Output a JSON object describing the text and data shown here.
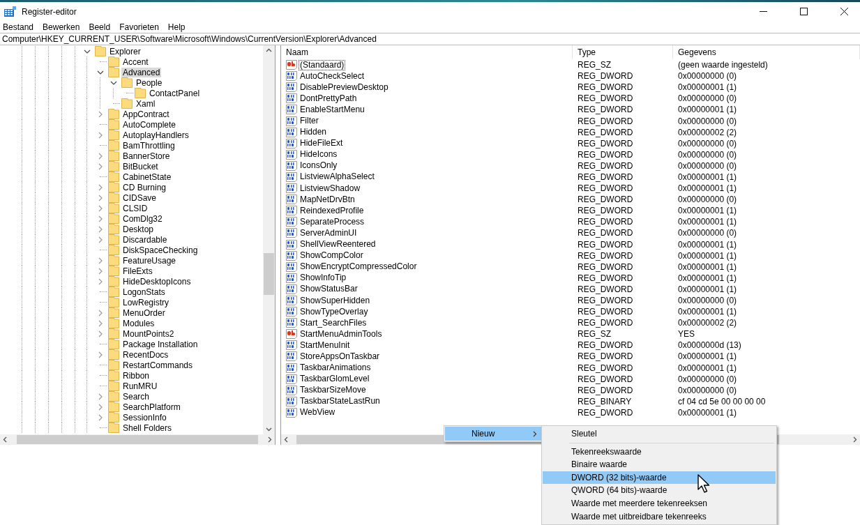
{
  "window": {
    "title": "Register-editor"
  },
  "menu": [
    "Bestand",
    "Bewerken",
    "Beeld",
    "Favorieten",
    "Help"
  ],
  "address": {
    "value": "Computer\\HKEY_CURRENT_USER\\Software\\Microsoft\\Windows\\CurrentVersion\\Explorer\\Advanced"
  },
  "tree": [
    {
      "label": "Explorer",
      "expandable": true,
      "expanded": true,
      "selected": false,
      "children": [
        {
          "label": "Accent",
          "expandable": false,
          "expanded": false,
          "selected": false
        },
        {
          "label": "Advanced",
          "expandable": true,
          "expanded": true,
          "selected": true,
          "children": [
            {
              "label": "People",
              "expandable": true,
              "expanded": true,
              "selected": false,
              "children": [
                {
                  "label": "ContactPanel",
                  "expandable": false,
                  "expanded": false,
                  "selected": false
                }
              ]
            },
            {
              "label": "Xaml",
              "expandable": false,
              "expanded": false,
              "selected": false
            }
          ]
        },
        {
          "label": "AppContract",
          "expandable": true,
          "expanded": false,
          "selected": false
        },
        {
          "label": "AutoComplete",
          "expandable": false,
          "expanded": false,
          "selected": false
        },
        {
          "label": "AutoplayHandlers",
          "expandable": true,
          "expanded": false,
          "selected": false
        },
        {
          "label": "BamThrottling",
          "expandable": false,
          "expanded": false,
          "selected": false
        },
        {
          "label": "BannerStore",
          "expandable": true,
          "expanded": false,
          "selected": false
        },
        {
          "label": "BitBucket",
          "expandable": true,
          "expanded": false,
          "selected": false
        },
        {
          "label": "CabinetState",
          "expandable": false,
          "expanded": false,
          "selected": false
        },
        {
          "label": "CD Burning",
          "expandable": true,
          "expanded": false,
          "selected": false
        },
        {
          "label": "CIDSave",
          "expandable": true,
          "expanded": false,
          "selected": false
        },
        {
          "label": "CLSID",
          "expandable": true,
          "expanded": false,
          "selected": false
        },
        {
          "label": "ComDlg32",
          "expandable": true,
          "expanded": false,
          "selected": false
        },
        {
          "label": "Desktop",
          "expandable": true,
          "expanded": false,
          "selected": false
        },
        {
          "label": "Discardable",
          "expandable": true,
          "expanded": false,
          "selected": false
        },
        {
          "label": "DiskSpaceChecking",
          "expandable": false,
          "expanded": false,
          "selected": false
        },
        {
          "label": "FeatureUsage",
          "expandable": true,
          "expanded": false,
          "selected": false
        },
        {
          "label": "FileExts",
          "expandable": true,
          "expanded": false,
          "selected": false
        },
        {
          "label": "HideDesktopIcons",
          "expandable": true,
          "expanded": false,
          "selected": false
        },
        {
          "label": "LogonStats",
          "expandable": false,
          "expanded": false,
          "selected": false
        },
        {
          "label": "LowRegistry",
          "expandable": false,
          "expanded": false,
          "selected": false
        },
        {
          "label": "MenuOrder",
          "expandable": true,
          "expanded": false,
          "selected": false
        },
        {
          "label": "Modules",
          "expandable": true,
          "expanded": false,
          "selected": false
        },
        {
          "label": "MountPoints2",
          "expandable": true,
          "expanded": false,
          "selected": false
        },
        {
          "label": "Package Installation",
          "expandable": false,
          "expanded": false,
          "selected": false
        },
        {
          "label": "RecentDocs",
          "expandable": true,
          "expanded": false,
          "selected": false
        },
        {
          "label": "RestartCommands",
          "expandable": false,
          "expanded": false,
          "selected": false
        },
        {
          "label": "Ribbon",
          "expandable": false,
          "expanded": false,
          "selected": false
        },
        {
          "label": "RunMRU",
          "expandable": false,
          "expanded": false,
          "selected": false
        },
        {
          "label": "Search",
          "expandable": true,
          "expanded": false,
          "selected": false
        },
        {
          "label": "SearchPlatform",
          "expandable": true,
          "expanded": false,
          "selected": false
        },
        {
          "label": "SessionInfo",
          "expandable": true,
          "expanded": false,
          "selected": false
        },
        {
          "label": "Shell Folders",
          "expandable": false,
          "expanded": false,
          "selected": false
        }
      ]
    }
  ],
  "table": {
    "columns": [
      "Naam",
      "Type",
      "Gegevens"
    ],
    "rows": [
      {
        "kind": "string",
        "focused": true,
        "name": "(Standaard)",
        "type": "REG_SZ",
        "data": "(geen waarde ingesteld)"
      },
      {
        "kind": "dword",
        "focused": false,
        "name": "AutoCheckSelect",
        "type": "REG_DWORD",
        "data": "0x00000000 (0)"
      },
      {
        "kind": "dword",
        "focused": false,
        "name": "DisablePreviewDesktop",
        "type": "REG_DWORD",
        "data": "0x00000001 (1)"
      },
      {
        "kind": "dword",
        "focused": false,
        "name": "DontPrettyPath",
        "type": "REG_DWORD",
        "data": "0x00000000 (0)"
      },
      {
        "kind": "dword",
        "focused": false,
        "name": "EnableStartMenu",
        "type": "REG_DWORD",
        "data": "0x00000001 (1)"
      },
      {
        "kind": "dword",
        "focused": false,
        "name": "Filter",
        "type": "REG_DWORD",
        "data": "0x00000000 (0)"
      },
      {
        "kind": "dword",
        "focused": false,
        "name": "Hidden",
        "type": "REG_DWORD",
        "data": "0x00000002 (2)"
      },
      {
        "kind": "dword",
        "focused": false,
        "name": "HideFileExt",
        "type": "REG_DWORD",
        "data": "0x00000000 (0)"
      },
      {
        "kind": "dword",
        "focused": false,
        "name": "HideIcons",
        "type": "REG_DWORD",
        "data": "0x00000000 (0)"
      },
      {
        "kind": "dword",
        "focused": false,
        "name": "IconsOnly",
        "type": "REG_DWORD",
        "data": "0x00000000 (0)"
      },
      {
        "kind": "dword",
        "focused": false,
        "name": "ListviewAlphaSelect",
        "type": "REG_DWORD",
        "data": "0x00000001 (1)"
      },
      {
        "kind": "dword",
        "focused": false,
        "name": "ListviewShadow",
        "type": "REG_DWORD",
        "data": "0x00000001 (1)"
      },
      {
        "kind": "dword",
        "focused": false,
        "name": "MapNetDrvBtn",
        "type": "REG_DWORD",
        "data": "0x00000000 (0)"
      },
      {
        "kind": "dword",
        "focused": false,
        "name": "ReindexedProfile",
        "type": "REG_DWORD",
        "data": "0x00000001 (1)"
      },
      {
        "kind": "dword",
        "focused": false,
        "name": "SeparateProcess",
        "type": "REG_DWORD",
        "data": "0x00000001 (1)"
      },
      {
        "kind": "dword",
        "focused": false,
        "name": "ServerAdminUI",
        "type": "REG_DWORD",
        "data": "0x00000000 (0)"
      },
      {
        "kind": "dword",
        "focused": false,
        "name": "ShellViewReentered",
        "type": "REG_DWORD",
        "data": "0x00000001 (1)"
      },
      {
        "kind": "dword",
        "focused": false,
        "name": "ShowCompColor",
        "type": "REG_DWORD",
        "data": "0x00000001 (1)"
      },
      {
        "kind": "dword",
        "focused": false,
        "name": "ShowEncryptCompressedColor",
        "type": "REG_DWORD",
        "data": "0x00000001 (1)"
      },
      {
        "kind": "dword",
        "focused": false,
        "name": "ShowInfoTip",
        "type": "REG_DWORD",
        "data": "0x00000001 (1)"
      },
      {
        "kind": "dword",
        "focused": false,
        "name": "ShowStatusBar",
        "type": "REG_DWORD",
        "data": "0x00000001 (1)"
      },
      {
        "kind": "dword",
        "focused": false,
        "name": "ShowSuperHidden",
        "type": "REG_DWORD",
        "data": "0x00000000 (0)"
      },
      {
        "kind": "dword",
        "focused": false,
        "name": "ShowTypeOverlay",
        "type": "REG_DWORD",
        "data": "0x00000001 (1)"
      },
      {
        "kind": "dword",
        "focused": false,
        "name": "Start_SearchFiles",
        "type": "REG_DWORD",
        "data": "0x00000002 (2)"
      },
      {
        "kind": "string",
        "focused": false,
        "name": "StartMenuAdminTools",
        "type": "REG_SZ",
        "data": "YES"
      },
      {
        "kind": "dword",
        "focused": false,
        "name": "StartMenuInit",
        "type": "REG_DWORD",
        "data": "0x0000000d (13)"
      },
      {
        "kind": "dword",
        "focused": false,
        "name": "StoreAppsOnTaskbar",
        "type": "REG_DWORD",
        "data": "0x00000001 (1)"
      },
      {
        "kind": "dword",
        "focused": false,
        "name": "TaskbarAnimations",
        "type": "REG_DWORD",
        "data": "0x00000001 (1)"
      },
      {
        "kind": "dword",
        "focused": false,
        "name": "TaskbarGlomLevel",
        "type": "REG_DWORD",
        "data": "0x00000000 (0)"
      },
      {
        "kind": "dword",
        "focused": false,
        "name": "TaskbarSizeMove",
        "type": "REG_DWORD",
        "data": "0x00000000 (0)"
      },
      {
        "kind": "binary",
        "focused": false,
        "name": "TaskbarStateLastRun",
        "type": "REG_BINARY",
        "data": "cf 04 cd 5e 00 00 00 00"
      },
      {
        "kind": "dword",
        "focused": false,
        "name": "WebView",
        "type": "REG_DWORD",
        "data": "0x00000001 (1)"
      }
    ]
  },
  "context_menu": {
    "items": [
      {
        "label": "Nieuw",
        "selected": true
      }
    ]
  },
  "submenu": {
    "groups": [
      [
        {
          "label": "Sleutel",
          "selected": false
        }
      ],
      [
        {
          "label": "Tekenreekswaarde",
          "selected": false
        },
        {
          "label": "Binaire waarde",
          "selected": false
        },
        {
          "label": "DWORD (32 bits)-waarde",
          "selected": true
        },
        {
          "label": "QWORD (64 bits)-waarde",
          "selected": false
        },
        {
          "label": "Waarde met meerdere tekenreeksen",
          "selected": false
        },
        {
          "label": "Waarde met uitbreidbare tekenreeks",
          "selected": false
        }
      ]
    ]
  }
}
